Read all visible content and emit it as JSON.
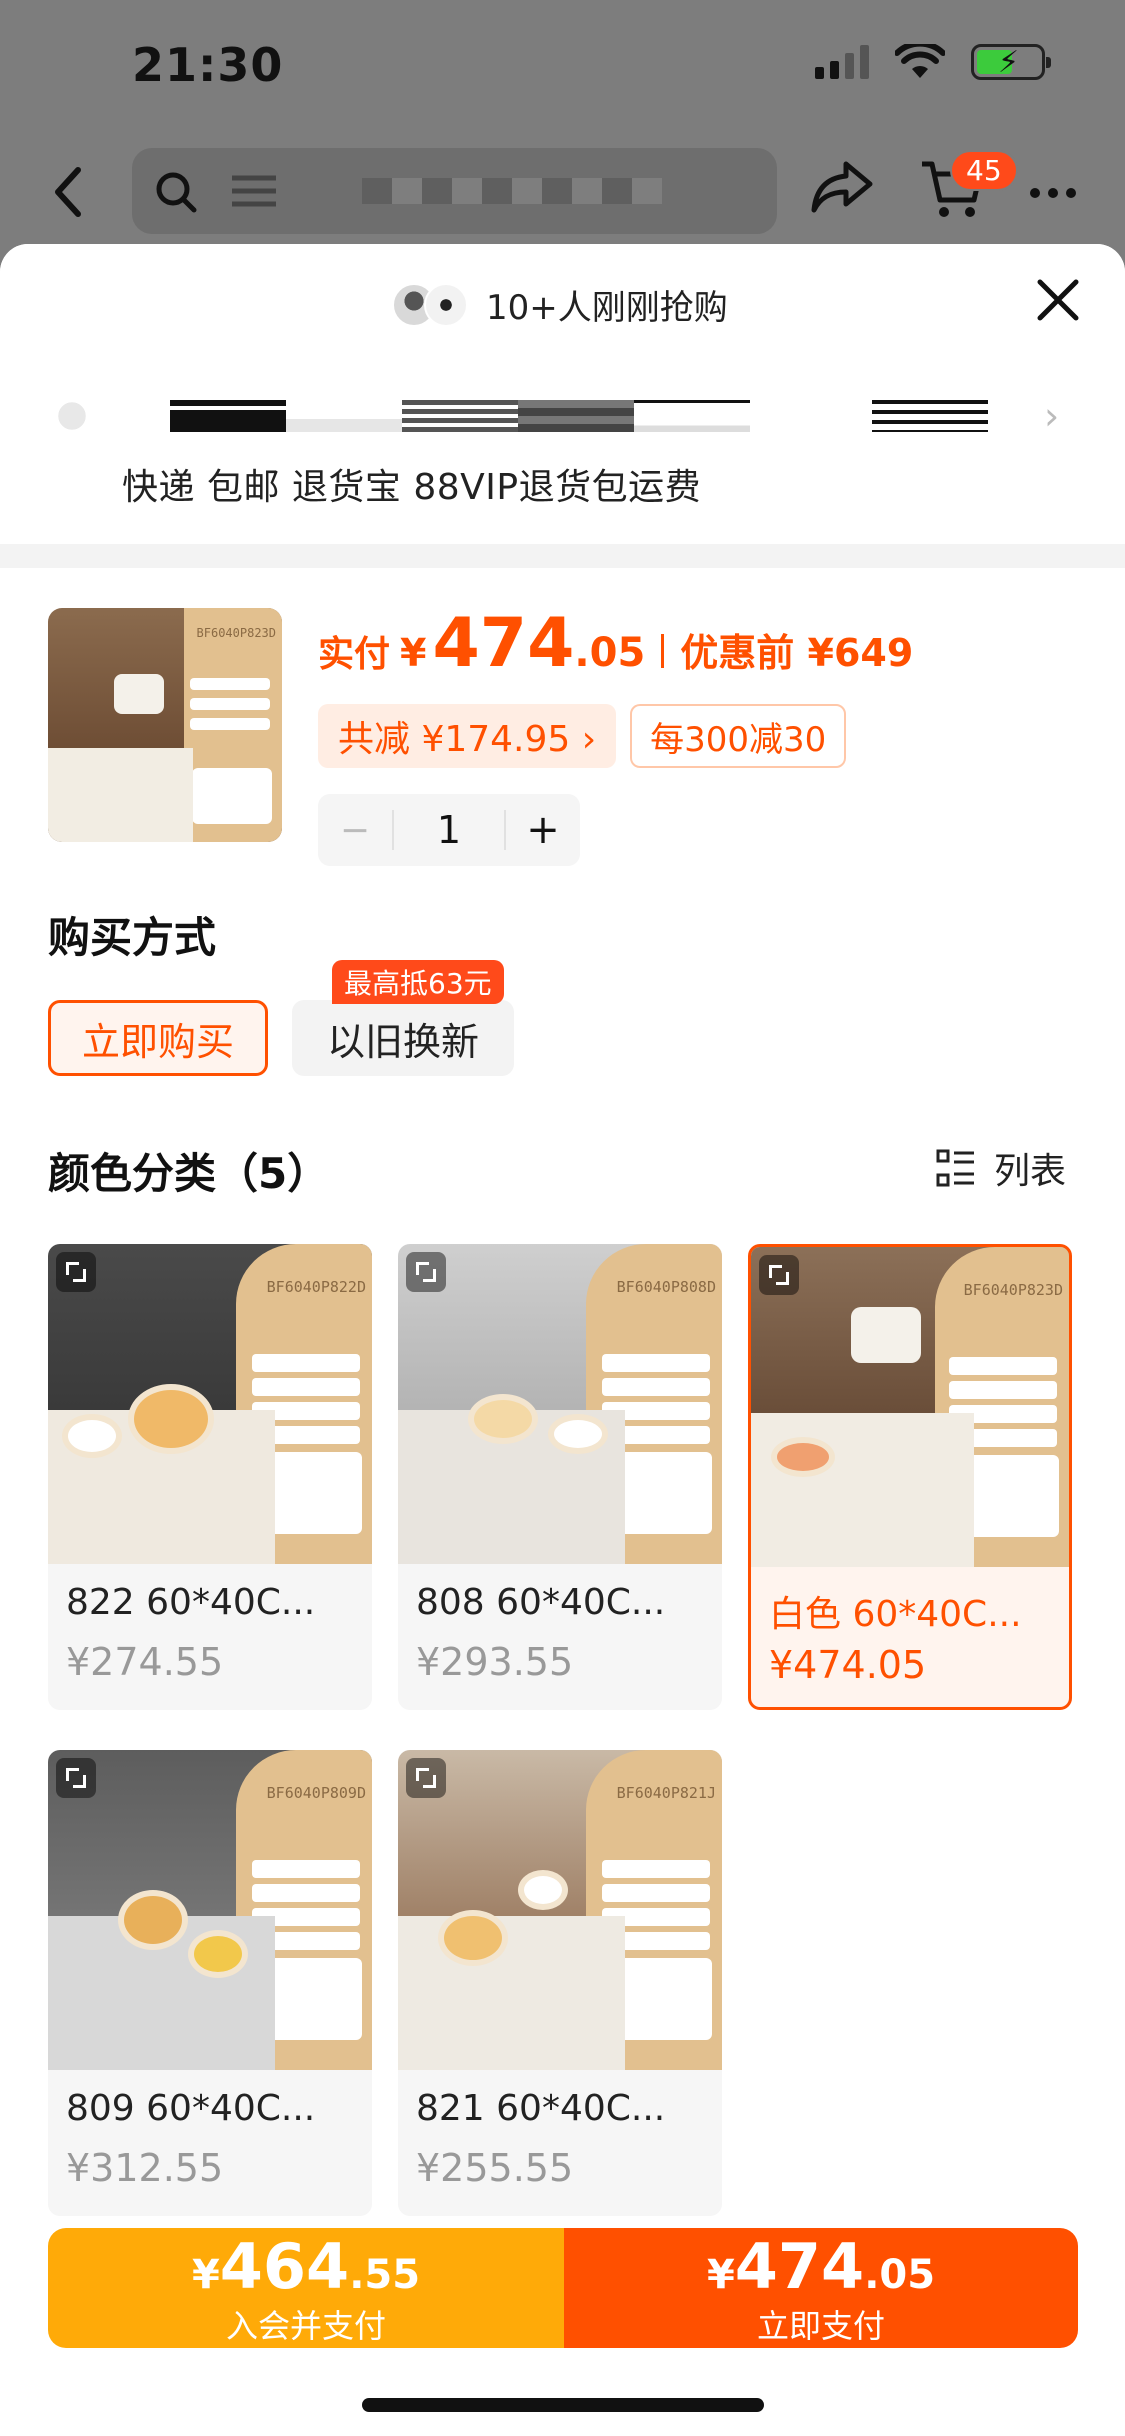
{
  "status_bar": {
    "time": "21:30"
  },
  "nav": {
    "cart_badge": "45"
  },
  "sheet": {
    "buyers_text": "10+人刚刚抢购",
    "service_line": "快递 包邮 退货宝 88VIP退货包运费"
  },
  "product": {
    "price_label": "实付",
    "currency": "¥",
    "price_int": "474",
    "price_dec": ".05",
    "original_price": "优惠前 ¥649",
    "save_chip": "共减 ¥174.95 ›",
    "rule_chip": "每300减30",
    "quantity": "1",
    "minus": "−",
    "plus": "+"
  },
  "buy_method": {
    "title": "购买方式",
    "buy_now": "立即购买",
    "trade_in": "以旧换新",
    "trade_in_tag": "最高抵63元"
  },
  "colors": {
    "title": "颜色分类（5）",
    "list_toggle": "列表",
    "items": [
      {
        "name": "822 60*40C...",
        "price": "¥274.55",
        "code": "BF6040P822D",
        "selected": false
      },
      {
        "name": "808 60*40C...",
        "price": "¥293.55",
        "code": "BF6040P808D",
        "selected": false
      },
      {
        "name": "白色 60*40C...",
        "price": "¥474.05",
        "code": "BF6040P823D",
        "selected": true
      },
      {
        "name": "809 60*40C...",
        "price": "¥312.55",
        "code": "BF6040P809D",
        "selected": false
      },
      {
        "name": "821 60*40C...",
        "price": "¥255.55",
        "code": "BF6040P821J",
        "selected": false
      }
    ]
  },
  "bottom_bar": {
    "member_price_int": "464",
    "member_price_dec": ".55",
    "member_label": "入会并支付",
    "now_price_int": "474",
    "now_price_dec": ".05",
    "now_label": "立即支付",
    "currency": "¥"
  },
  "colors_theme": {
    "accent": "#ff5000",
    "member": "#ffaa08"
  }
}
